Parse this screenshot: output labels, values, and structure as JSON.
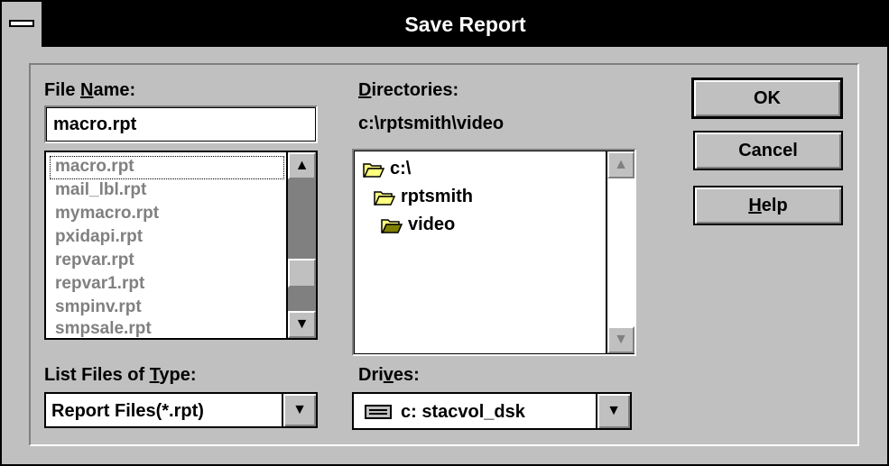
{
  "window": {
    "title": "Save Report"
  },
  "file_name": {
    "label_pre": "File ",
    "label_key": "N",
    "label_post": "ame:",
    "value": "macro.rpt",
    "files": [
      "macro.rpt",
      "mail_lbl.rpt",
      "mymacro.rpt",
      "pxidapi.rpt",
      "repvar.rpt",
      "repvar1.rpt",
      "smpinv.rpt",
      "smpsale.rpt"
    ]
  },
  "directories": {
    "label_key": "D",
    "label_post": "irectories:",
    "current_path": "c:\\rptsmith\\video",
    "items": [
      "c:\\",
      "rptsmith",
      "video"
    ]
  },
  "file_type": {
    "label_pre": "List Files of ",
    "label_key": "T",
    "label_post": "ype:",
    "value": "Report Files(*.rpt)"
  },
  "drives": {
    "label_pre": "Dri",
    "label_key": "v",
    "label_post": "es:",
    "value": "c: stacvol_dsk"
  },
  "buttons": {
    "ok": "OK",
    "cancel": "Cancel",
    "help_key": "H",
    "help_post": "elp"
  }
}
